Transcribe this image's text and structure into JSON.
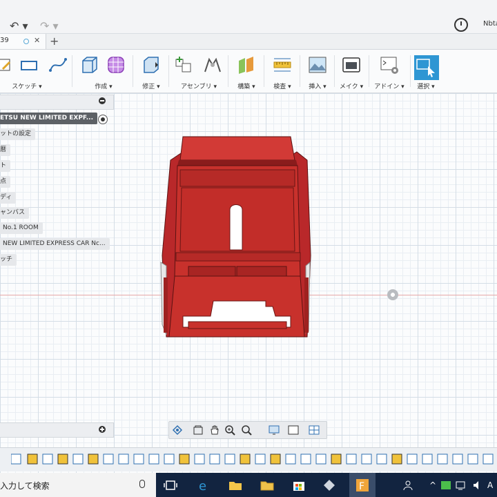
{
  "app": {
    "undo_icon": "undo-icon",
    "redo_icon": "redo-icon",
    "user_label": "Nbta"
  },
  "tab": {
    "label": "39",
    "close": "✕",
    "new_tab": "+"
  },
  "toolbar": {
    "groups": [
      {
        "label": "スケッチ ▾"
      },
      {
        "label": "作成 ▾"
      },
      {
        "label": "修正 ▾"
      },
      {
        "label": "アセンブリ ▾"
      },
      {
        "label": "構築 ▾"
      },
      {
        "label": "検査 ▾"
      },
      {
        "label": "挿入 ▾"
      },
      {
        "label": "メイク ▾"
      },
      {
        "label": "アドイン ▾"
      },
      {
        "label": "選択 ▾"
      }
    ]
  },
  "browser": {
    "items": [
      {
        "label": "ETSU NEW LIMITED EXPF..."
      },
      {
        "label": "ットの設定"
      },
      {
        "label": "暦"
      },
      {
        "label": "ト"
      },
      {
        "label": "点"
      },
      {
        "label": "ディ"
      },
      {
        "label": "ャンバス"
      },
      {
        "label": "No.1 ROOM"
      },
      {
        "label": "NEW LIMITED EXPRESS CAR Nc..."
      },
      {
        "label": "ッチ"
      }
    ]
  },
  "taskbar": {
    "search_text": "入力して検索",
    "tray_text": "A"
  },
  "colors": {
    "accent": "#2e96d3",
    "model_red": "#c8312c",
    "taskbar": "#122440"
  }
}
